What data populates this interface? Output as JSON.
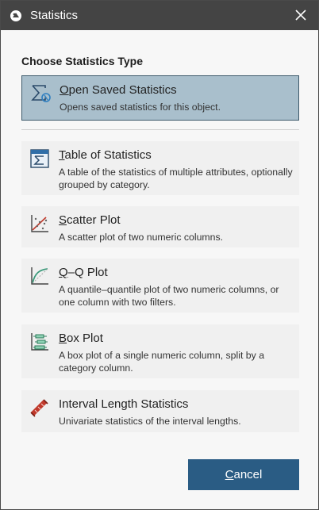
{
  "window": {
    "title": "Statistics"
  },
  "section_label": "Choose Statistics Type",
  "options": [
    {
      "mnemonic": "O",
      "rest": "pen Saved Statistics",
      "description": "Opens saved statistics for this object.",
      "icon": "sigma-icon",
      "selected": true
    },
    {
      "mnemonic": "T",
      "rest": "able of Statistics",
      "description": "A table of the statistics of multiple attributes, optionally grouped by category.",
      "icon": "table-sigma-icon"
    },
    {
      "mnemonic": "S",
      "rest": "catter Plot",
      "description": "A scatter plot of two numeric columns.",
      "icon": "scatter-plot-icon"
    },
    {
      "mnemonic": "Q",
      "rest": "–Q Plot",
      "description": "A quantile–quantile plot of two numeric columns, or one column with two filters.",
      "icon": "qq-plot-icon"
    },
    {
      "mnemonic": "B",
      "rest": "ox Plot",
      "description": "A box plot of a single numeric column, split by a category column.",
      "icon": "box-plot-icon"
    },
    {
      "mnemonic": "",
      "rest": "Interval Length Statistics",
      "description": "Univariate statistics of the interval lengths.",
      "icon": "interval-icon"
    }
  ],
  "cancel": {
    "mnemonic": "C",
    "rest": "ancel"
  },
  "colors": {
    "accent": "#2a5c84",
    "selected_bg": "#a9bfcc",
    "titlebar": "#444444"
  }
}
